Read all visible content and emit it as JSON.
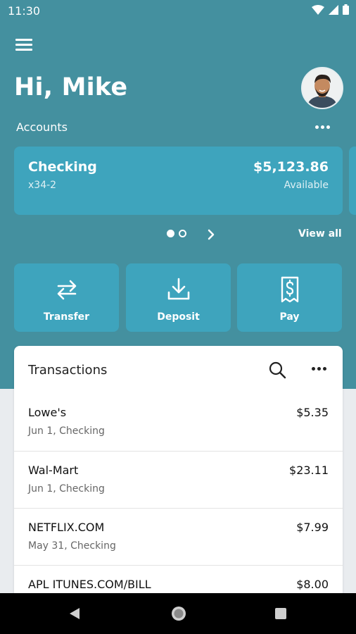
{
  "status_bar": {
    "time": "11:30",
    "icons": [
      "wifi-icon",
      "signal-icon",
      "battery-icon"
    ]
  },
  "header": {
    "greeting": "Hi, Mike",
    "menu_icon": "hamburger-menu-icon",
    "avatar_icon": "user-avatar"
  },
  "accounts": {
    "label": "Accounts",
    "more_icon": "more-horizontal-icon",
    "cards": [
      {
        "name": "Checking",
        "number": "x34-2",
        "balance": "$5,123.86",
        "balance_label": "Available"
      }
    ],
    "pager": {
      "pages": 2,
      "active": 0
    },
    "view_all": "View all"
  },
  "actions": [
    {
      "label": "Transfer",
      "icon": "transfer-arrows-icon"
    },
    {
      "label": "Deposit",
      "icon": "download-tray-icon"
    },
    {
      "label": "Pay",
      "icon": "dollar-receipt-icon"
    }
  ],
  "transactions": {
    "title": "Transactions",
    "search_icon": "search-icon",
    "more_icon": "more-horizontal-icon",
    "items": [
      {
        "merchant": "Lowe's",
        "meta": "Jun 1, Checking",
        "amount": "$5.35"
      },
      {
        "merchant": "Wal-Mart",
        "meta": "Jun 1, Checking",
        "amount": "$23.11"
      },
      {
        "merchant": "NETFLIX.COM",
        "meta": "May 31, Checking",
        "amount": "$7.99"
      },
      {
        "merchant": "APL ITUNES.COM/BILL",
        "meta": "",
        "amount": "$8.00"
      }
    ]
  },
  "nav_bar": {
    "icons": [
      "back-triangle-icon",
      "home-circle-icon",
      "recents-square-icon"
    ]
  },
  "colors": {
    "hero_bg": "#44909f",
    "card_bg": "#3ea4bd",
    "page_bg": "#e9ecef",
    "nav_bg": "#000000"
  }
}
